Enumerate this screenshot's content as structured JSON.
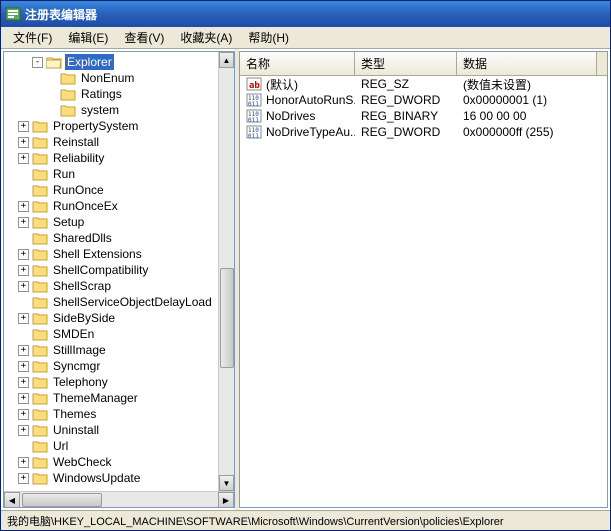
{
  "title": "注册表编辑器",
  "menu": {
    "file": "文件(F)",
    "edit": "编辑(E)",
    "view": "查看(V)",
    "favorites": "收藏夹(A)",
    "help": "帮助(H)"
  },
  "tree": [
    {
      "depth": 2,
      "label": "Explorer",
      "selected": true,
      "open": true,
      "expander": "-"
    },
    {
      "depth": 3,
      "label": "NonEnum"
    },
    {
      "depth": 3,
      "label": "Ratings"
    },
    {
      "depth": 3,
      "label": "system"
    },
    {
      "depth": 1,
      "label": "PropertySystem",
      "expander": "+"
    },
    {
      "depth": 1,
      "label": "Reinstall",
      "expander": "+"
    },
    {
      "depth": 1,
      "label": "Reliability",
      "expander": "+"
    },
    {
      "depth": 1,
      "label": "Run"
    },
    {
      "depth": 1,
      "label": "RunOnce"
    },
    {
      "depth": 1,
      "label": "RunOnceEx",
      "expander": "+"
    },
    {
      "depth": 1,
      "label": "Setup",
      "expander": "+"
    },
    {
      "depth": 1,
      "label": "SharedDlls"
    },
    {
      "depth": 1,
      "label": "Shell Extensions",
      "expander": "+"
    },
    {
      "depth": 1,
      "label": "ShellCompatibility",
      "expander": "+"
    },
    {
      "depth": 1,
      "label": "ShellScrap",
      "expander": "+"
    },
    {
      "depth": 1,
      "label": "ShellServiceObjectDelayLoad"
    },
    {
      "depth": 1,
      "label": "SideBySide",
      "expander": "+"
    },
    {
      "depth": 1,
      "label": "SMDEn"
    },
    {
      "depth": 1,
      "label": "StillImage",
      "expander": "+"
    },
    {
      "depth": 1,
      "label": "Syncmgr",
      "expander": "+"
    },
    {
      "depth": 1,
      "label": "Telephony",
      "expander": "+"
    },
    {
      "depth": 1,
      "label": "ThemeManager",
      "expander": "+"
    },
    {
      "depth": 1,
      "label": "Themes",
      "expander": "+"
    },
    {
      "depth": 1,
      "label": "Uninstall",
      "expander": "+"
    },
    {
      "depth": 1,
      "label": "Url"
    },
    {
      "depth": 1,
      "label": "WebCheck",
      "expander": "+"
    },
    {
      "depth": 1,
      "label": "WindowsUpdate",
      "expander": "+"
    }
  ],
  "columns": {
    "name": "名称",
    "type": "类型",
    "data": "数据"
  },
  "values": [
    {
      "icon": "string",
      "name": "(默认)",
      "type": "REG_SZ",
      "data": "(数值未设置)"
    },
    {
      "icon": "binary",
      "name": "HonorAutoRunS...",
      "type": "REG_DWORD",
      "data": "0x00000001 (1)"
    },
    {
      "icon": "binary",
      "name": "NoDrives",
      "type": "REG_BINARY",
      "data": "16 00 00 00"
    },
    {
      "icon": "binary",
      "name": "NoDriveTypeAu...",
      "type": "REG_DWORD",
      "data": "0x000000ff (255)"
    }
  ],
  "statusbar": "我的电脑\\HKEY_LOCAL_MACHINE\\SOFTWARE\\Microsoft\\Windows\\CurrentVersion\\policies\\Explorer",
  "colwidths": {
    "name": 115,
    "type": 102,
    "data": 140
  }
}
